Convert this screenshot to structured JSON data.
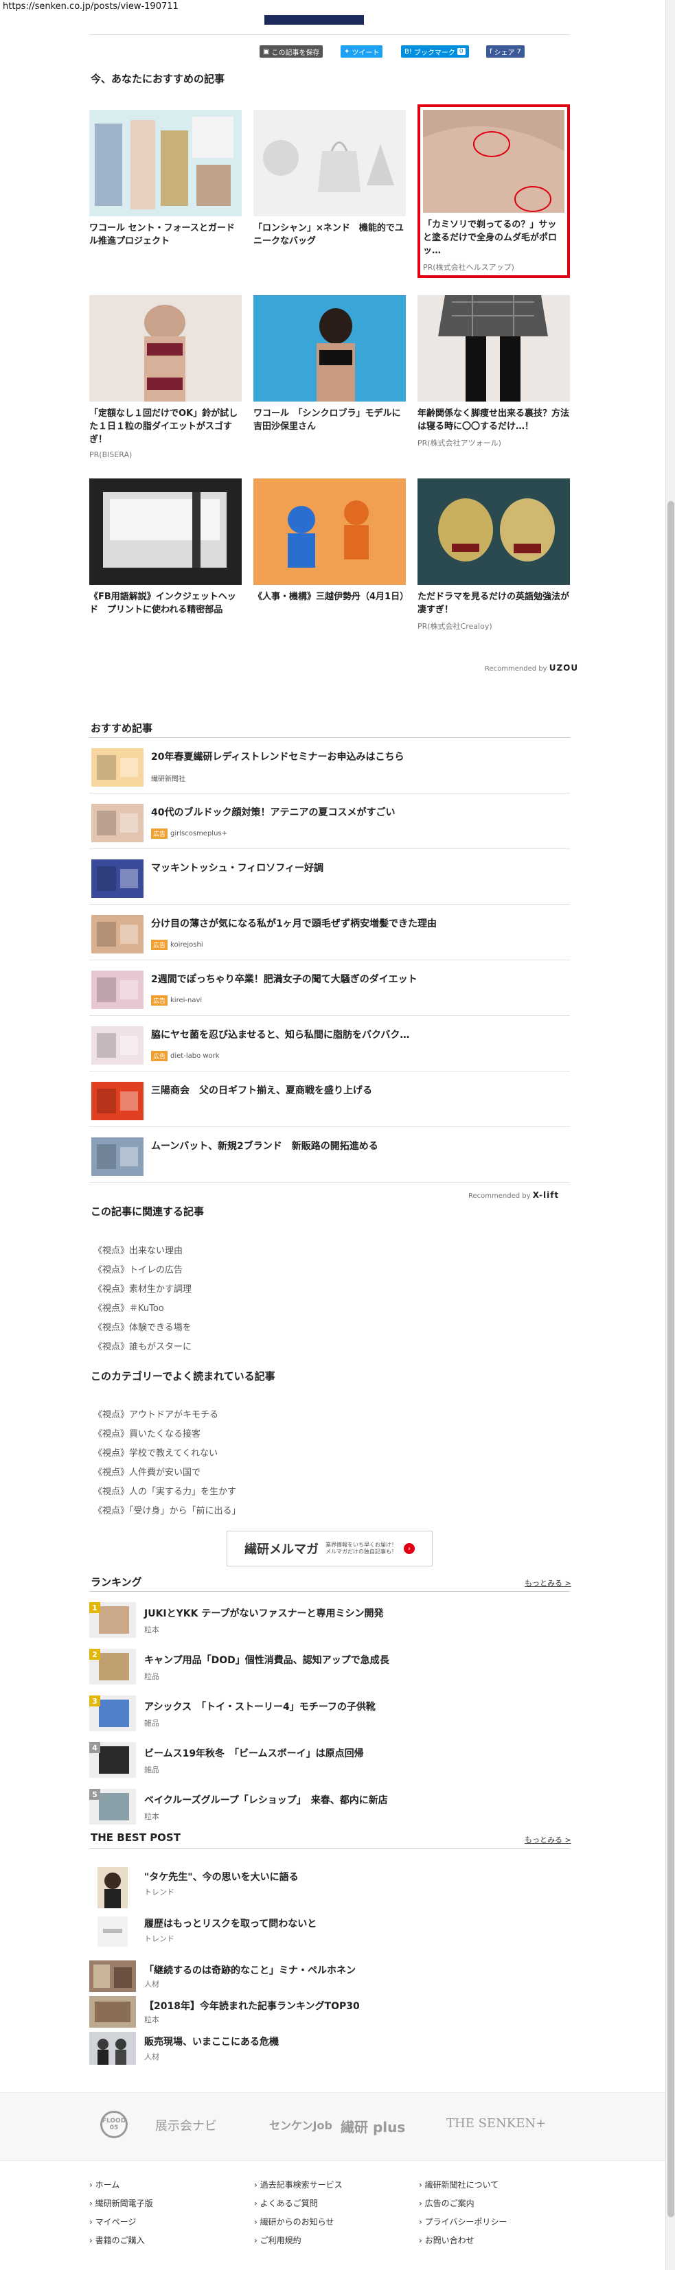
{
  "browser": {
    "url": "https://senken.co.jp/posts/view-190711"
  },
  "share": {
    "save_label": "この記事を保存",
    "tweet_label": "ツイート",
    "hatena_label": "ブックマーク",
    "hatena_count": "0",
    "fb_label": "シェア",
    "fb_count": "7"
  },
  "recommended_now": {
    "title": "今、あなたにおすすめの記事",
    "cards": [
      {
        "caption": "ワコール セント・フォースとガードル推進プロジェクト",
        "pr": ""
      },
      {
        "caption": "「ロンシャン」×ネンド　機能的でユニークなバッグ",
        "pr": ""
      },
      {
        "caption": "「カミソリで剃ってるの？」サッと塗るだけで全身のムダ毛がポロッ…",
        "pr": "PR(株式会社ヘルスアップ)"
      },
      {
        "caption": "「定額なし１回だけでOK」鈴が試した１日１粒の脂ダイエットがスゴすぎ！",
        "pr": "PR(BISERA)"
      },
      {
        "caption": "ワコール　「シンクロブラ」モデルに吉田沙保里さん",
        "pr": ""
      },
      {
        "caption": "年齢関係なく脚痩せ出来る裏技？方法は寝る時に〇〇するだけ…！",
        "pr": "PR(株式会社アツォール)"
      },
      {
        "caption": "《FB用語解説》インクジェットヘッド　プリントに使われる精密部品",
        "pr": ""
      },
      {
        "caption": "《人事・機構》三越伊勢丹（4月1日）",
        "pr": ""
      },
      {
        "caption": "ただドラマを見るだけの英語勉強法が凄すぎ！",
        "pr": "PR(株式会社Crealoy)"
      }
    ],
    "recommended_by": "Recommended by",
    "recommended_brand": "UZOU"
  },
  "osusume": {
    "title": "おすすめ記事",
    "items": [
      {
        "title": "20年春夏繊研レディストレンドセミナーお申込みはこちら",
        "tag": "",
        "source": "繊研新聞社"
      },
      {
        "title": "40代のブルドック顔対策！アテニアの夏コスメがすごい",
        "tag": "広告",
        "source": "girlscosmeplus+"
      },
      {
        "title": "マッキントッシュ・フィロソフィー好調",
        "tag": "",
        "source": ""
      },
      {
        "title": "分け目の薄さが気になる私が1ヶ月で頭毛ぜず柄安増髪できた理由",
        "tag": "広告",
        "source": "koirejoshi"
      },
      {
        "title": "2週間でぽっちゃり卒業！肥満女子の聞て大騒ぎのダイエット",
        "tag": "広告",
        "source": "kirei-navi"
      },
      {
        "title": "脇にヤセ菌を忍び込ませると、知ら私間に脂肪をバクバク…",
        "tag": "広告",
        "source": "diet-labo work"
      },
      {
        "title": "三陽商会　父の日ギフト揃え、夏商戦を盛り上げる",
        "tag": "",
        "source": ""
      },
      {
        "title": "ムーンバット、新規2ブランド　新販路の開拓進める",
        "tag": "",
        "source": ""
      }
    ],
    "recommended_by": "Recommended by",
    "recommended_brand": "X-lift"
  },
  "related": {
    "title": "この記事に関連する記事",
    "links": [
      "《視点》出来ない理由",
      "《視点》トイレの広告",
      "《視点》素材生かす調理",
      "《視点》＃KuToo",
      "《視点》体験できる場を",
      "《視点》誰もがスターに"
    ]
  },
  "popular": {
    "title": "このカテゴリーでよく読まれている記事",
    "links": [
      "《視点》アウトドアがキモチる",
      "《視点》買いたくなる接客",
      "《視点》学校で教えてくれない",
      "《視点》人件費が安い国で",
      "《視点》人の「実する力」を生かす",
      "《視点》「受け身」から「前に出る」"
    ]
  },
  "mailmag": {
    "title": "繊研メルマガ",
    "sub1": "業界情報をいち早くお届け！",
    "sub2": "メルマガだけの独自記事も！"
  },
  "ranking": {
    "title": "ランキング",
    "more": "もっとみる >",
    "items": [
      {
        "rank": "1",
        "title": "JUKIとYKK テープがないファスナーと専用ミシン開発",
        "category": "粒本"
      },
      {
        "rank": "2",
        "title": "キャンプ用品「DOD」個性消費品、認知アップで急成長",
        "category": "粒品"
      },
      {
        "rank": "3",
        "title": "アシックス　「トイ・ストーリー4」モチーフの子供靴",
        "category": "雑品"
      },
      {
        "rank": "4",
        "title": "ビームス19年秋冬　「ビームスボーイ」は原点回帰",
        "category": "雑品"
      },
      {
        "rank": "5",
        "title": "ベイクルーズグループ「レショップ」　来春、都内に新店",
        "category": "粒本"
      }
    ]
  },
  "best_post": {
    "title": "THE BEST POST",
    "more": "もっとみる >",
    "items": [
      {
        "title": "\"タケ先生\"、今の思いを大いに語る",
        "category": "トレンド"
      },
      {
        "title": "履歴はもっとリスクを取って問わないと",
        "category": "トレンド"
      },
      {
        "title": "「継続するのは奇跡的なこと」ミナ・ペルホネン",
        "category": "人材"
      },
      {
        "title": "【2018年】今年読まれた記事ランキングTOP30",
        "category": "粒本"
      },
      {
        "title": "販売現場、いまここにある危機",
        "category": "人材"
      }
    ]
  },
  "footer_logos": [
    "FLOOD 05",
    "展示会ナビ",
    "センケンJob",
    "繊研 plus",
    "THE SENKEN+"
  ],
  "footer_links": [
    [
      "ホーム",
      "繊研新聞電子版",
      "マイページ",
      "書籍のご購入"
    ],
    [
      "過去記事検索サービス",
      "よくあるご質問",
      "繊研からのお知らせ",
      "ご利用規約"
    ],
    [
      "繊研新聞社について",
      "広告のご案内",
      "プライバシーポリシー",
      "お問い合わせ"
    ]
  ],
  "colors": {
    "ad_border": "#e00012",
    "navy": "#1d2a5c",
    "rank_gold": "#e3b60a"
  }
}
